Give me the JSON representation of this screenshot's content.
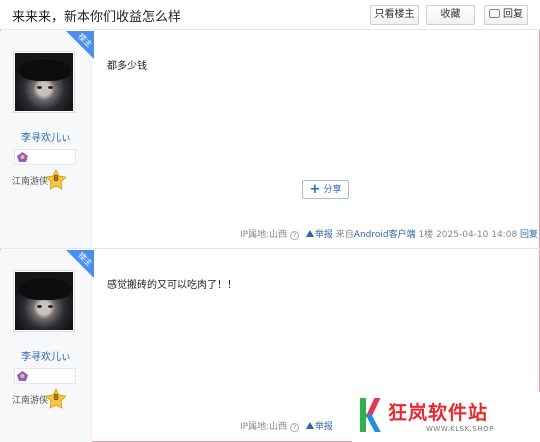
{
  "header": {
    "title": "来来来，新本你们收益怎么样",
    "only_op_label": "只看楼主",
    "favorite_label": "收藏",
    "reply_label": "回复"
  },
  "posts": [
    {
      "badge": "楼主",
      "username": "李寻欢儿ぃ",
      "member_title": "江南游侠",
      "level": "8",
      "content": "都多少钱",
      "share_label": "分享",
      "ip": "IP属地:山西",
      "report_label": "举报",
      "source_prefix": "来自",
      "source": "Android客户端",
      "floor": "1楼",
      "time": "2025-04-10 14:08",
      "reply_label": "回复"
    },
    {
      "badge": "楼主",
      "username": "李寻欢儿ぃ",
      "member_title": "江南游侠",
      "level": "8",
      "content": "感觉搬砖的又可以吃肉了！！",
      "ip": "IP属地:山西",
      "report_label": "举报"
    }
  ],
  "watermark": {
    "brand": "狂岚软件站",
    "url": "WWW.KLSK.SHOP"
  },
  "colors": {
    "link": "#2d64b3",
    "badge": "#4a8ef0",
    "frame": "#f19ca8",
    "brand_red": "#e8282e"
  }
}
